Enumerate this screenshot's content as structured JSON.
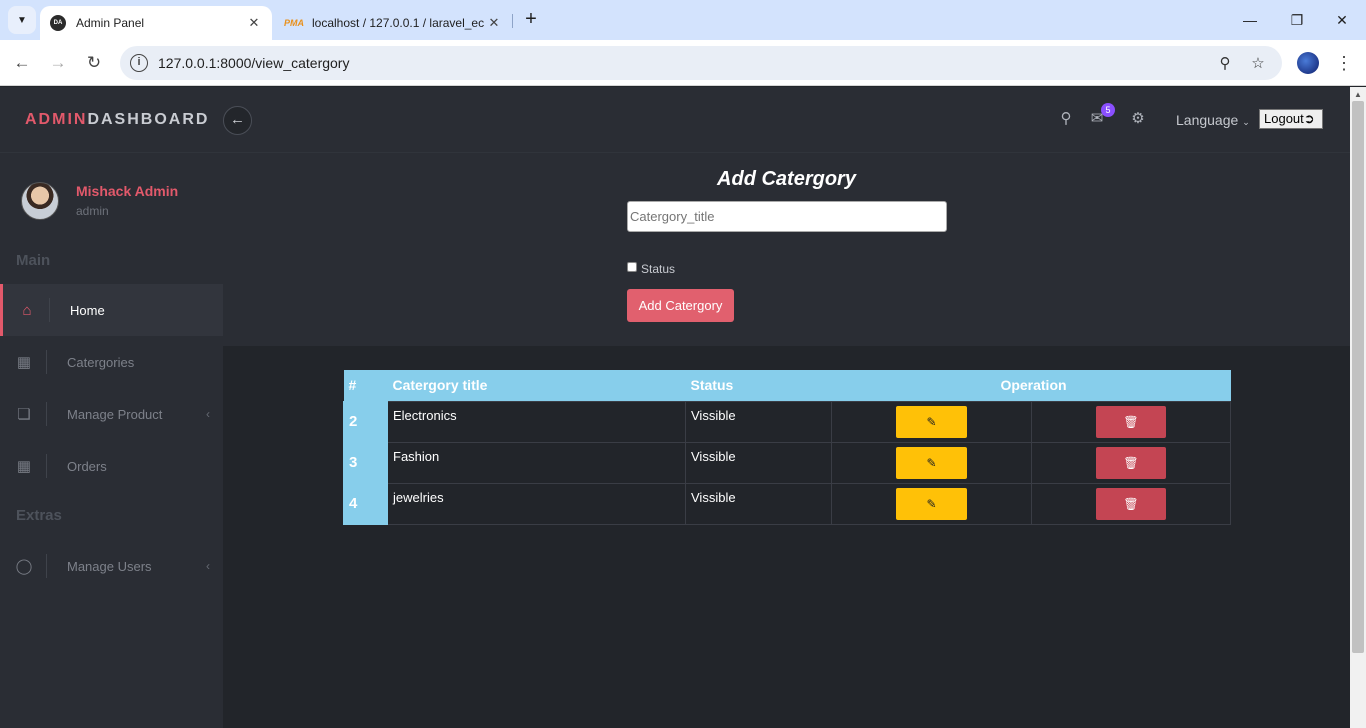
{
  "browser": {
    "tabs": [
      {
        "favicon": "DA",
        "title": "Admin Panel"
      },
      {
        "favicon": "PMA",
        "title": "localhost / 127.0.0.1 / laravel_ec"
      }
    ],
    "url": "127.0.0.1:8000/view_catergory",
    "icons": {
      "tab_search": "chevron-down-icon",
      "close": "close-icon",
      "new_tab": "plus-icon",
      "back": "back-arrow-icon",
      "forward": "forward-arrow-icon",
      "reload": "reload-icon",
      "site_info": "info-icon",
      "zoom": "zoom-icon",
      "bookmark": "star-icon",
      "menu": "more-vertical-icon"
    }
  },
  "header": {
    "brand_part1": "ADMIN",
    "brand_part2": "DASHBOARD",
    "mail_count": "5",
    "language_label": "Language",
    "logout_label": "Logout",
    "colors": {
      "accent": "#e2596b",
      "badge": "#8a4fff"
    }
  },
  "sidebar": {
    "user_name": "Mishack Admin",
    "user_role": "admin",
    "section_main": "Main",
    "section_extras": "Extras",
    "items": [
      {
        "label": "Home",
        "icon": "home-icon",
        "active": true
      },
      {
        "label": "Catergories",
        "icon": "grid-icon"
      },
      {
        "label": "Manage Product",
        "icon": "window-icon",
        "chevron": "‹"
      },
      {
        "label": "Orders",
        "icon": "grid-icon"
      },
      {
        "label": "Manage Users",
        "icon": "user-icon",
        "chevron": "‹"
      }
    ]
  },
  "form": {
    "title": "Add Catergory",
    "title_placeholder": "Catergory_title",
    "status_label": "Status",
    "submit_label": "Add Catergory"
  },
  "table": {
    "headers": {
      "num": "#",
      "title": "Catergory title",
      "status": "Status",
      "operation": "Operation"
    },
    "rows": [
      {
        "id": "2",
        "title": "Electronics",
        "status": "Vissible"
      },
      {
        "id": "3",
        "title": "Fashion",
        "status": "Vissible"
      },
      {
        "id": "4",
        "title": "jewelries",
        "status": "Vissible"
      }
    ],
    "colors": {
      "header": "#87ceeb",
      "edit": "#ffc107",
      "delete": "#c44553"
    }
  }
}
